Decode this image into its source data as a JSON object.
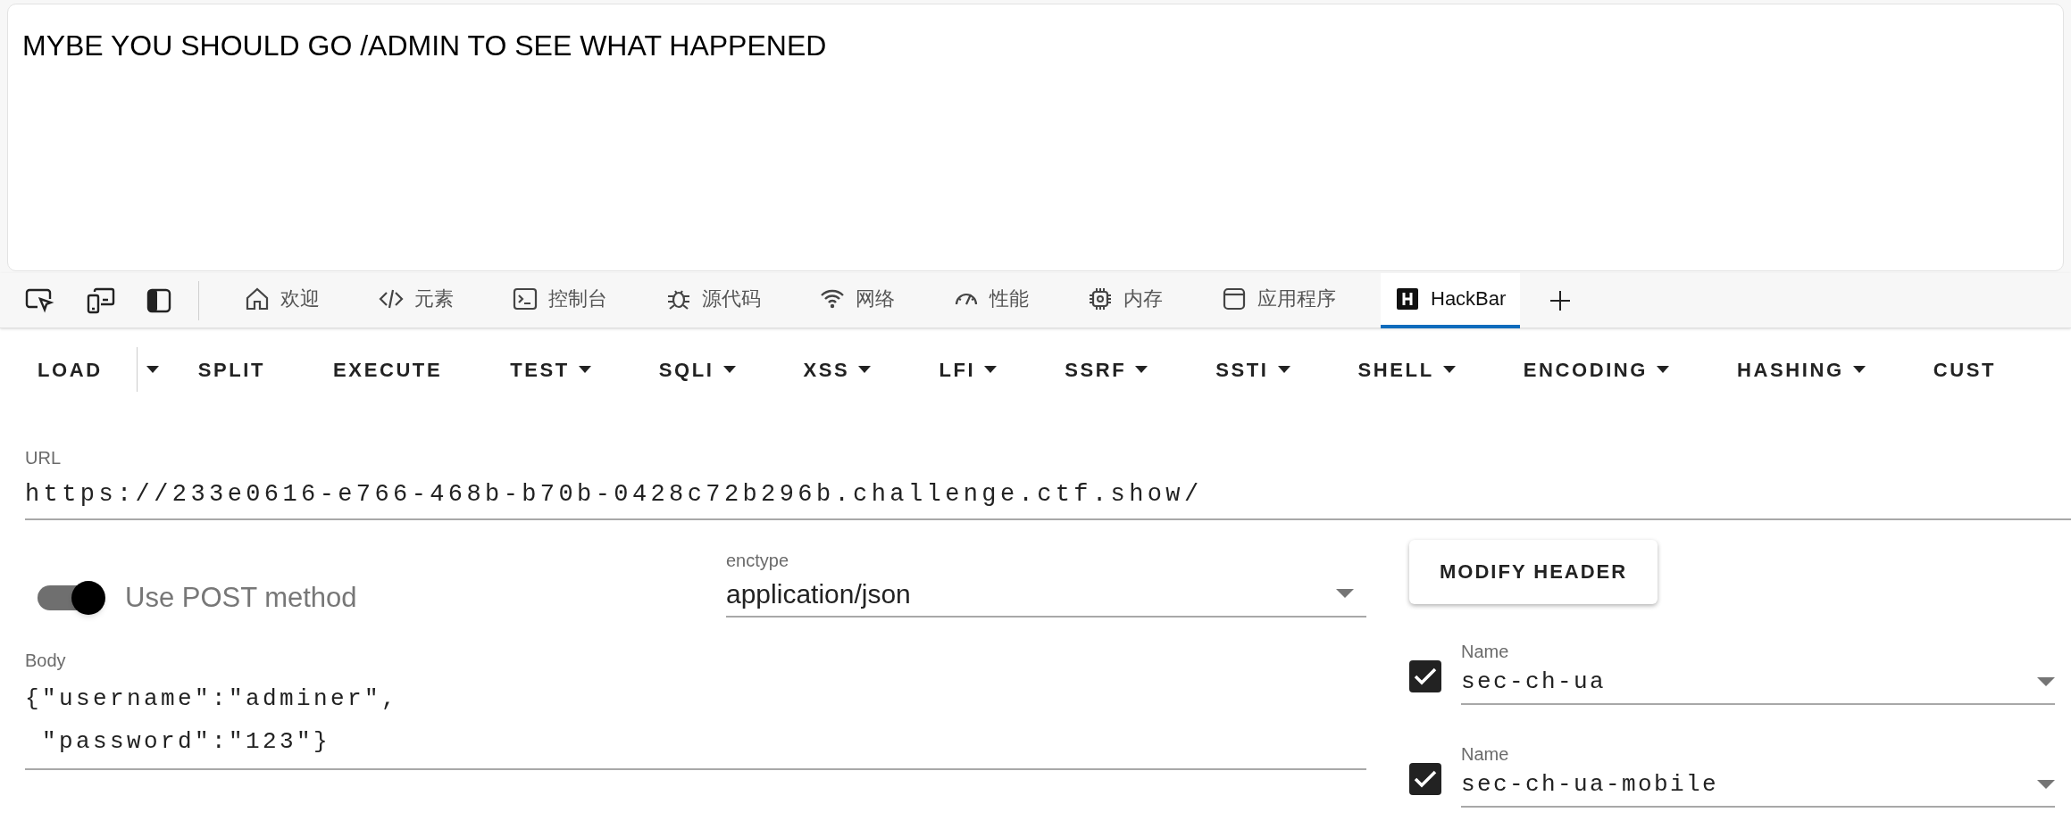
{
  "page": {
    "message": "MYBE YOU SHOULD GO /ADMIN TO SEE WHAT HAPPENED"
  },
  "devtools": {
    "tabs": [
      {
        "label": "欢迎",
        "kind": "home",
        "selected": false
      },
      {
        "label": "元素",
        "kind": "code",
        "selected": false
      },
      {
        "label": "控制台",
        "kind": "console",
        "selected": false
      },
      {
        "label": "源代码",
        "kind": "bug",
        "selected": false
      },
      {
        "label": "网络",
        "kind": "wifi",
        "selected": false
      },
      {
        "label": "性能",
        "kind": "gauge",
        "selected": false
      },
      {
        "label": "内存",
        "kind": "chip",
        "selected": false
      },
      {
        "label": "应用程序",
        "kind": "app",
        "selected": false
      },
      {
        "label": "HackBar",
        "kind": "hackbar",
        "selected": true
      }
    ]
  },
  "hackbar": {
    "menu": [
      {
        "label": "LOAD",
        "kind": "split"
      },
      {
        "label": "SPLIT",
        "kind": "button"
      },
      {
        "label": "EXECUTE",
        "kind": "button"
      },
      {
        "label": "TEST",
        "kind": "menu"
      },
      {
        "label": "SQLI",
        "kind": "menu"
      },
      {
        "label": "XSS",
        "kind": "menu"
      },
      {
        "label": "LFI",
        "kind": "menu"
      },
      {
        "label": "SSRF",
        "kind": "menu"
      },
      {
        "label": "SSTI",
        "kind": "menu"
      },
      {
        "label": "SHELL",
        "kind": "menu"
      },
      {
        "label": "ENCODING",
        "kind": "menu"
      },
      {
        "label": "HASHING",
        "kind": "menu"
      },
      {
        "label": "CUST",
        "kind": "button"
      }
    ],
    "url": {
      "label": "URL",
      "value": "https://233e0616-e766-468b-b70b-0428c72b296b.challenge.ctf.show/"
    },
    "post": {
      "label": "Use POST method",
      "on": true
    },
    "enctype": {
      "label": "enctype",
      "value": "application/json"
    },
    "modify_header_button": "MODIFY HEADER",
    "body": {
      "label": "Body",
      "value": "{\"username\":\"adminer\",\n \"password\":\"123\"}"
    },
    "headers": [
      {
        "label": "Name",
        "value": "sec-ch-ua",
        "checked": true
      },
      {
        "label": "Name",
        "value": "sec-ch-ua-mobile",
        "checked": true
      }
    ]
  }
}
